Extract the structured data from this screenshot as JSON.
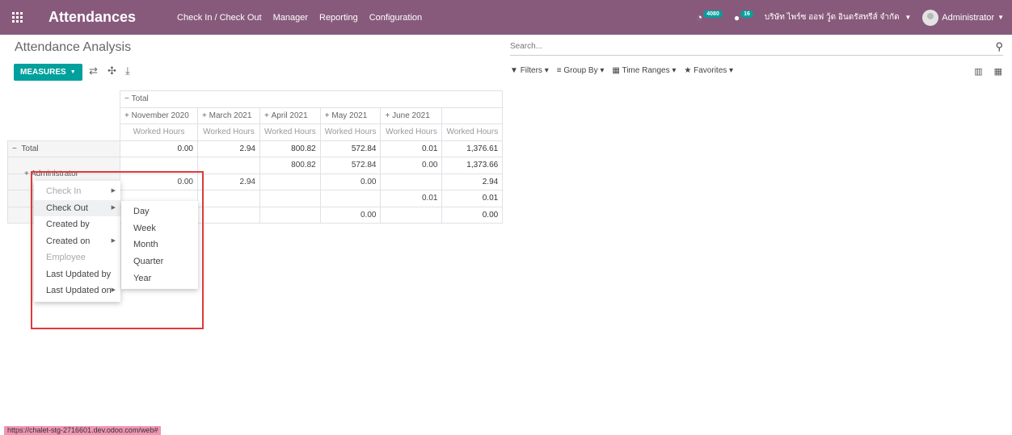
{
  "navbar": {
    "brand": "Attendances",
    "menu": [
      "Check In / Check Out",
      "Manager",
      "Reporting",
      "Configuration"
    ],
    "activity_count": "4080",
    "messages_count": "16",
    "company": "บริษัท ไพร์ซ ออฟ วู้ด อินดรัสทรีส์ จำกัด",
    "user": "Administrator"
  },
  "control_panel": {
    "title": "Attendance Analysis",
    "search_placeholder": "Search...",
    "measures_label": "MEASURES",
    "filters_label": "Filters",
    "groupby_label": "Group By",
    "timeranges_label": "Time Ranges",
    "favorites_label": "Favorites"
  },
  "pivot": {
    "total_label": "Total",
    "measure_label": "Worked Hours",
    "columns": [
      "November 2020",
      "March 2021",
      "April 2021",
      "May 2021",
      "June 2021"
    ],
    "rows": [
      {
        "label": "Total",
        "values": [
          "0.00",
          "2.94",
          "800.82",
          "572.84",
          "0.01",
          "1,376.61"
        ]
      },
      {
        "label": "Administrator",
        "values": [
          "",
          "",
          "800.82",
          "572.84",
          "0.00",
          "1,373.66"
        ]
      },
      {
        "label": "",
        "values": [
          "0.00",
          "2.94",
          "",
          "0.00",
          "",
          "2.94"
        ]
      },
      {
        "label": "",
        "values": [
          "",
          "",
          "",
          "",
          "0.01",
          "0.01"
        ]
      },
      {
        "label": "",
        "values": [
          "",
          "",
          "",
          "0.00",
          "",
          "0.00"
        ]
      }
    ]
  },
  "groupby_menu": {
    "items": [
      "Check In",
      "Check Out",
      "Created by",
      "Created on",
      "Employee",
      "Last Updated by",
      "Last Updated on"
    ]
  },
  "interval_menu": {
    "items": [
      "Day",
      "Week",
      "Month",
      "Quarter",
      "Year"
    ]
  },
  "status_url": "https://chalet-stg-2716601.dev.odoo.com/web#",
  "colors": {
    "brand": "#875a7b",
    "primary": "#00a09d",
    "highlight": "#e0393b"
  }
}
